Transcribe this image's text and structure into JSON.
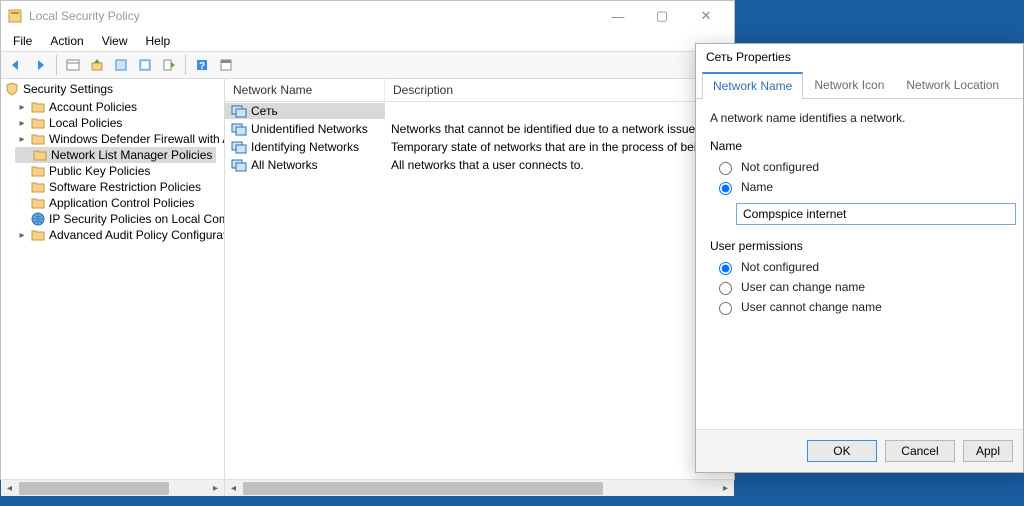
{
  "main_window": {
    "title": "Local Security Policy",
    "menu": {
      "file": "File",
      "action": "Action",
      "view": "View",
      "help": "Help"
    },
    "tree": {
      "root": "Security Settings",
      "items": [
        {
          "label": "Account Policies",
          "expandable": true
        },
        {
          "label": "Local Policies",
          "expandable": true
        },
        {
          "label": "Windows Defender Firewall with Advan",
          "expandable": true
        },
        {
          "label": "Network List Manager Policies",
          "expandable": false,
          "selected": true
        },
        {
          "label": "Public Key Policies",
          "expandable": false
        },
        {
          "label": "Software Restriction Policies",
          "expandable": false
        },
        {
          "label": "Application Control Policies",
          "expandable": false
        },
        {
          "label": "IP Security Policies on Local Computer",
          "expandable": false,
          "icon": "globe"
        },
        {
          "label": "Advanced Audit Policy Configuration",
          "expandable": true
        }
      ]
    },
    "list": {
      "columns": {
        "name": "Network Name",
        "desc": "Description"
      },
      "rows": [
        {
          "name": "Сеть",
          "desc": "",
          "selected": true
        },
        {
          "name": "Unidentified Networks",
          "desc": "Networks that cannot be identified due to a network issue or lack"
        },
        {
          "name": "Identifying Networks",
          "desc": "Temporary state of networks that are in the process of being iden"
        },
        {
          "name": "All Networks",
          "desc": "All networks that a user connects to."
        }
      ]
    }
  },
  "dialog": {
    "title": "Сеть Properties",
    "tabs": {
      "t0": "Network Name",
      "t1": "Network Icon",
      "t2": "Network Location"
    },
    "intro": "A network name identifies a network.",
    "name_group": {
      "title": "Name",
      "opt_not_conf": "Not configured",
      "opt_name": "Name",
      "value": "Compspice internet"
    },
    "perm_group": {
      "title": "User permissions",
      "opt_not_conf": "Not configured",
      "opt_can": "User can change name",
      "opt_cannot": "User cannot change name"
    },
    "buttons": {
      "ok": "OK",
      "cancel": "Cancel",
      "apply": "Appl"
    }
  }
}
